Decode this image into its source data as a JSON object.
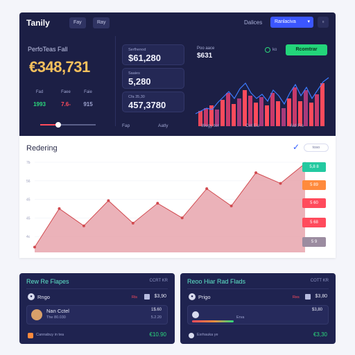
{
  "app": {
    "title": "Tanily"
  },
  "header": {
    "tabs": [
      "Fay",
      "Ray"
    ],
    "link": "Dalices",
    "select": "Ranlaciva",
    "icon": "square-icon"
  },
  "left": {
    "label": "PerfoTeas Fall",
    "big_value": "€348,731",
    "mini_cols": [
      {
        "label": "Fad",
        "value": "1993",
        "color": "#2bd97c"
      },
      {
        "label": "Faee",
        "value": "7.6-",
        "color": "#ff4b5c"
      },
      {
        "label": "Faie",
        "value": "915",
        "color": "#9ea4d0"
      }
    ],
    "slider_fraction": 0.33
  },
  "stats": [
    {
      "label": "Serfhenod",
      "value": "$61,280"
    },
    {
      "label": "Saaies",
      "value": "5,280"
    },
    {
      "label": "Cfa 35,30",
      "value": "457,3780"
    }
  ],
  "top_chart": {
    "label": "Poo aace",
    "value": "$631",
    "radio_label": "ko",
    "button": "Rcomtrar",
    "bottom_labels": [
      "Fap",
      "Aatly",
      "Wegy ter",
      "Cet Eu",
      "Aid Fis"
    ]
  },
  "middle": {
    "title": "Redering",
    "pill": "toso",
    "side_pills": [
      {
        "label": "5,8 8",
        "color": "#23c9a0"
      },
      {
        "label": "5 89",
        "color": "#ff8a3d"
      },
      {
        "label": "5 60",
        "color": "#ff4b5c"
      },
      {
        "label": "5 68",
        "color": "#ff4b5c"
      },
      {
        "label": "5 9",
        "color": "#9b8ca0"
      }
    ]
  },
  "chart_data": {
    "type": "area",
    "ytick_labels": [
      "7b",
      "56",
      "45",
      "45",
      "4c"
    ],
    "values": [
      4,
      33,
      20,
      39,
      22,
      37,
      26,
      48,
      35,
      60,
      52,
      67
    ],
    "ylim": [
      0,
      70
    ],
    "colors": {
      "fill": "#e8a5ad",
      "line": "#d14a4f"
    }
  },
  "cards": [
    {
      "title": "Rew Re Flapes",
      "link": "CCRT KR",
      "row_icon": "user-icon",
      "row_label": "Rngo",
      "row_tag": "Ris",
      "row_value": "$3,90",
      "inner_name": "Nan Cctel",
      "inner_sub": "The 80.030",
      "inner_value": "1$.60",
      "inner_value2": "5.2.20",
      "foot_label": "Cannabuy in tea",
      "foot_value": "€10.90",
      "foot_color": "#ff8a3d"
    },
    {
      "title": "Reoo Hiar Rad Flads",
      "link": "COTT KR",
      "row_icon": "user-icon",
      "row_label": "Prigo",
      "row_tag": "Res",
      "row_value": "$3,80",
      "inner_name": "",
      "inner_sub": "Erva",
      "inner_value": "$3,80",
      "inner_value2": "",
      "foot_label": "Exrhauka ye",
      "foot_value": "€3,30",
      "foot_color": "#d8dbee"
    }
  ]
}
